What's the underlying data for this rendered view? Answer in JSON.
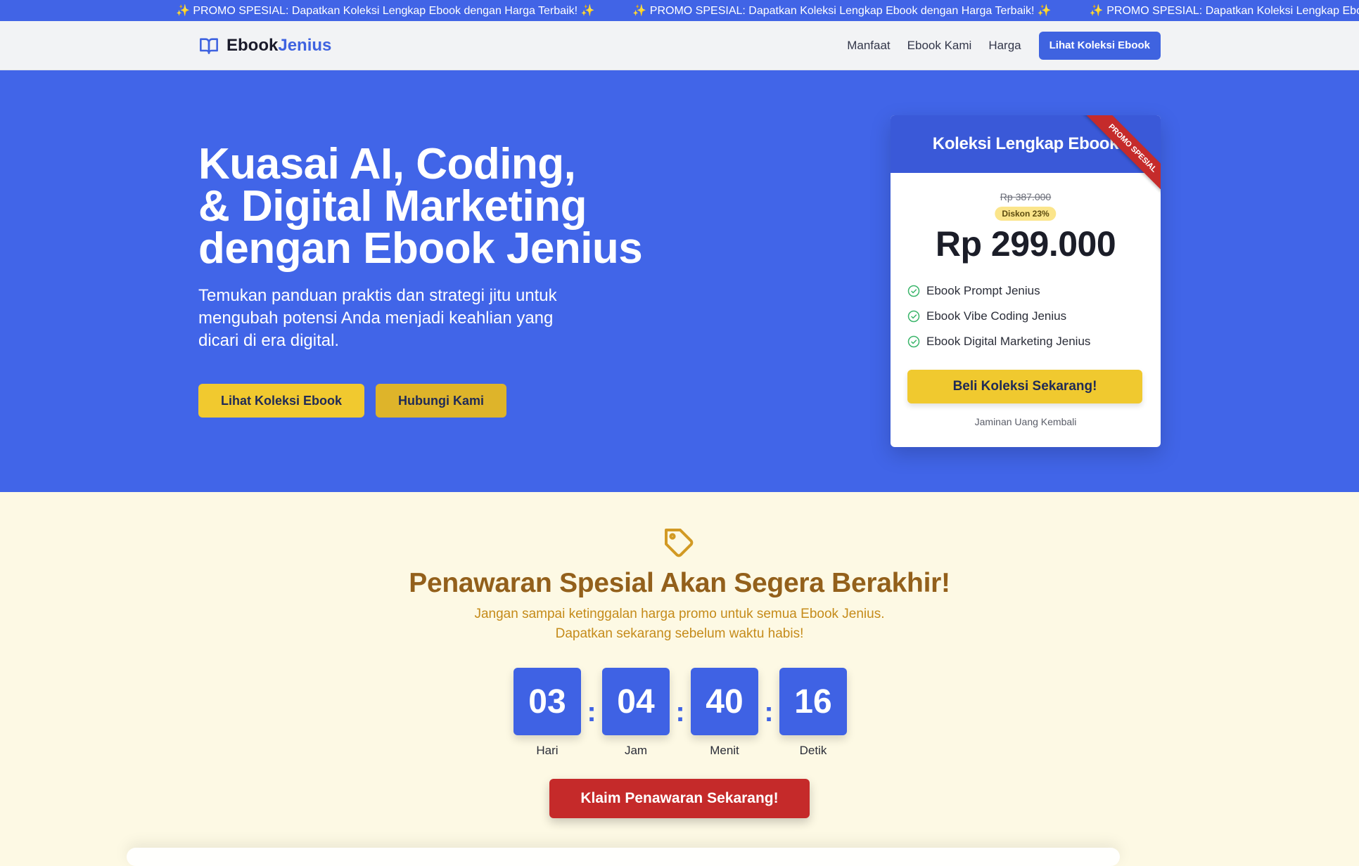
{
  "promo_bar": {
    "items": [
      "✨ PROMO SPESIAL: Dapatkan Koleksi Lengkap Ebook dengan Harga Terbaik! ✨",
      "✨ PROMO SPESIAL: Dapatkan Koleksi Lengkap Ebook dengan Harga Terbaik! ✨",
      "✨ PROMO SPESIAL: Dapatkan Koleksi Lengkap Ebook dengan Harga Terbaik! ✨"
    ]
  },
  "navbar": {
    "brand_a": "Ebook",
    "brand_b": "Jenius",
    "brand_icon": "open-book-icon",
    "links": [
      "Manfaat",
      "Ebook Kami",
      "Harga"
    ],
    "cta": "Lihat Koleksi Ebook"
  },
  "hero": {
    "title_lines": [
      "Kuasai AI, Coding,",
      "& Digital Marketing",
      "dengan Ebook Jenius"
    ],
    "subtitle": "Temukan panduan praktis dan strategi jitu untuk mengubah potensi Anda menjadi keahlian yang dicari di era digital.",
    "btn_primary": "Lihat Koleksi Ebook",
    "btn_secondary": "Hubungi Kami"
  },
  "price_card": {
    "title": "Koleksi Lengkap Ebook",
    "ribbon": "PROMO SPESIAL",
    "old_price": "Rp 387.000",
    "discount": "Diskon 23%",
    "price": "Rp 299.000",
    "features": [
      "Ebook Prompt Jenius",
      "Ebook Vibe Coding Jenius",
      "Ebook Digital Marketing Jenius"
    ],
    "buy_button": "Beli Koleksi Sekarang!",
    "guarantee": "Jaminan Uang Kembali"
  },
  "offer": {
    "icon": "tag-icon",
    "title": "Penawaran Spesial Akan Segera Berakhir!",
    "subtitle_lines": [
      "Jangan sampai ketinggalan harga promo untuk semua Ebook Jenius.",
      "Dapatkan sekarang sebelum waktu habis!"
    ],
    "countdown": [
      {
        "value": "03",
        "label": "Hari"
      },
      {
        "value": "04",
        "label": "Jam"
      },
      {
        "value": "40",
        "label": "Menit"
      },
      {
        "value": "16",
        "label": "Detik"
      }
    ],
    "separator": ":",
    "claim_button": "Klaim Penawaran Sekarang!"
  },
  "colors": {
    "primary": "#4165e8",
    "accent_yellow": "#f1c92f",
    "accent_red": "#c52a2a",
    "offer_bg": "#fdf9e4",
    "offer_title": "#93601b"
  }
}
